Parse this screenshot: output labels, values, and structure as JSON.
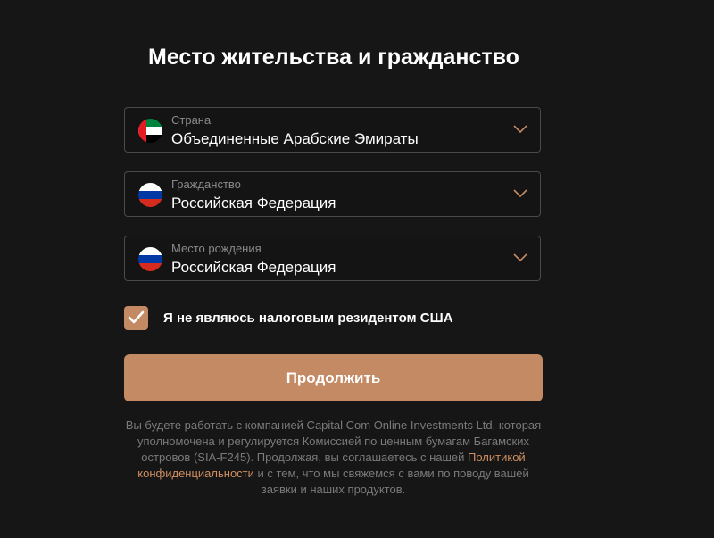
{
  "page": {
    "title": "Место жительства и гражданство"
  },
  "fields": {
    "country": {
      "label": "Страна",
      "value": "Объединенные Арабские Эмираты",
      "flag": "uae-flag"
    },
    "citizenship": {
      "label": "Гражданство",
      "value": "Российская Федерация",
      "flag": "russia-flag"
    },
    "birthplace": {
      "label": "Место рождения",
      "value": "Российская Федерация",
      "flag": "russia-flag"
    }
  },
  "tax_checkbox": {
    "checked": true,
    "label": "Я не являюсь налоговым резидентом США"
  },
  "continue_button": {
    "label": "Продолжить"
  },
  "disclaimer": {
    "text_before": "Вы будете работать с компанией Capital Com Online Investments Ltd, которая уполномочена и регулируется Комиссией по ценным бумагам Багамских островов (SIA-F245). Продолжая, вы соглашаетесь с нашей ",
    "link": "Политикой конфиденциальности",
    "text_after": " и с тем, что мы свяжемся с вами по поводу вашей заявки и наших продуктов."
  },
  "colors": {
    "background": "#161616",
    "accent": "#c38a63",
    "link": "#d08f62",
    "field_border": "#4a4a4a",
    "muted_text": "#7a7a7a"
  }
}
